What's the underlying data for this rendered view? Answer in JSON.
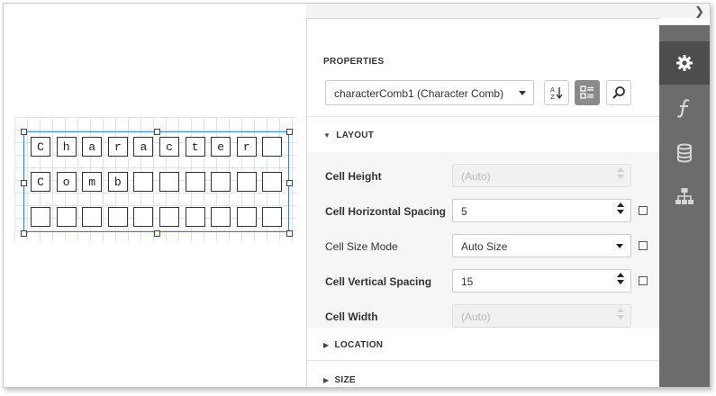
{
  "surface": {
    "comb": {
      "rows": [
        [
          "C",
          "h",
          "a",
          "r",
          "a",
          "c",
          "t",
          "e",
          "r",
          ""
        ],
        [
          "C",
          "o",
          "m",
          "b",
          "",
          "",
          "",
          "",
          "",
          ""
        ],
        [
          "",
          "",
          "",
          "",
          "",
          "",
          "",
          "",
          "",
          ""
        ]
      ]
    }
  },
  "panel": {
    "title": "PROPERTIES",
    "selector_value": "characterComb1 (Character Comb)",
    "sections": {
      "layout": "LAYOUT",
      "location": "LOCATION",
      "size": "SIZE"
    },
    "properties": [
      {
        "label": "Cell Height",
        "value": "(Auto)",
        "bold": true,
        "editor": "spin",
        "disabled": true
      },
      {
        "label": "Cell Horizontal Spacing",
        "value": "5",
        "bold": true,
        "editor": "spin",
        "disabled": false
      },
      {
        "label": "Cell Size Mode",
        "value": "Auto Size",
        "bold": false,
        "editor": "select",
        "disabled": false
      },
      {
        "label": "Cell Vertical Spacing",
        "value": "15",
        "bold": true,
        "editor": "spin",
        "disabled": false
      },
      {
        "label": "Cell Width",
        "value": "(Auto)",
        "bold": true,
        "editor": "spin",
        "disabled": true
      }
    ]
  },
  "rail": {
    "icons": [
      "gear-icon",
      "function-icon",
      "database-icon",
      "hierarchy-icon"
    ],
    "active": "gear-icon"
  },
  "colors": {
    "selection_border": "#3f7fc1",
    "rail_bg": "#6c6c6c",
    "rail_active_bg": "#4d4d4d"
  }
}
